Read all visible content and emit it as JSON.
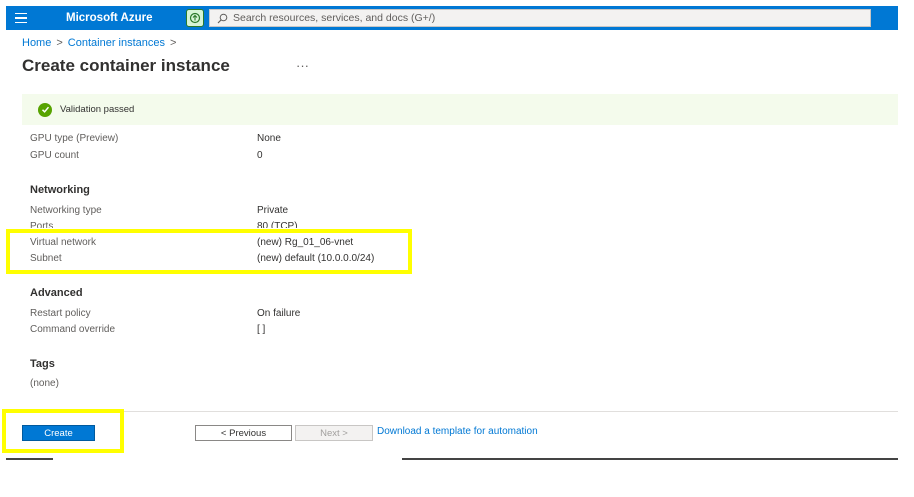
{
  "topbar": {
    "brand": "Microsoft Azure",
    "search_placeholder": "Search resources, services, and docs (G+/)"
  },
  "breadcrumb": {
    "items": [
      "Home",
      "Container instances"
    ],
    "sep": ">"
  },
  "page": {
    "title": "Create container instance",
    "more": "···"
  },
  "validation": {
    "text": "Validation passed"
  },
  "details": {
    "gpu_type_label": "GPU type (Preview)",
    "gpu_type_value": "None",
    "gpu_count_label": "GPU count",
    "gpu_count_value": "0"
  },
  "networking": {
    "heading": "Networking",
    "type_label": "Networking type",
    "type_value": "Private",
    "ports_label": "Ports",
    "ports_value": "80 (TCP)",
    "vnet_label": "Virtual network",
    "vnet_value": "(new) Rg_01_06-vnet",
    "subnet_label": "Subnet",
    "subnet_value": "(new) default (10.0.0.0/24)"
  },
  "advanced": {
    "heading": "Advanced",
    "restart_label": "Restart policy",
    "restart_value": "On failure",
    "command_label": "Command override",
    "command_value": "[ ]"
  },
  "tags": {
    "heading": "Tags",
    "value": "(none)"
  },
  "footer": {
    "create": "Create",
    "previous": "< Previous",
    "next": "Next >",
    "download": "Download a template for automation"
  },
  "colors": {
    "accent": "#0078d4",
    "highlight": "#ffff00",
    "success": "#57a300"
  }
}
